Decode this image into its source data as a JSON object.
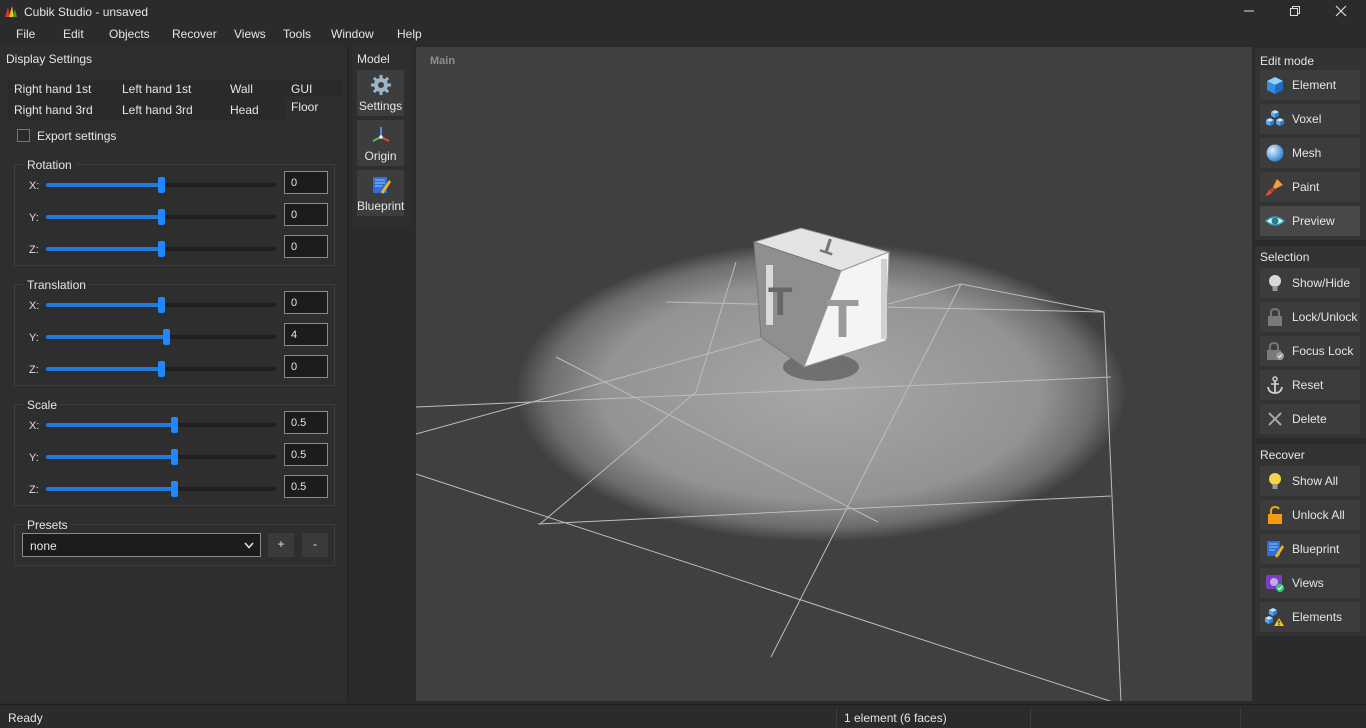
{
  "window": {
    "title": "Cubik Studio - unsaved"
  },
  "menu": [
    "File",
    "Edit",
    "Objects",
    "Recover",
    "Views",
    "Tools",
    "Window",
    "Help"
  ],
  "display_settings": {
    "title": "Display Settings",
    "tabs": [
      "Right hand 1st",
      "Left hand 1st",
      "Wall",
      "GUI",
      "Right hand 3rd",
      "Left hand 3rd",
      "Head",
      "Floor"
    ],
    "active_tab": "Floor",
    "export_label": "Export settings",
    "export_checked": false,
    "rotation": {
      "title": "Rotation",
      "x_label": "X:",
      "y_label": "Y:",
      "z_label": "Z:",
      "x": "0",
      "y": "0",
      "z": "0",
      "x_level": 0.5,
      "y_level": 0.5,
      "z_level": 0.5
    },
    "translation": {
      "title": "Translation",
      "x_label": "X:",
      "y_label": "Y:",
      "z_label": "Z:",
      "x": "0",
      "y": "4",
      "z": "0",
      "x_level": 0.5,
      "y_level": 0.525,
      "z_level": 0.5
    },
    "scale": {
      "title": "Scale",
      "x_label": "X:",
      "y_label": "Y:",
      "z_label": "Z:",
      "x": "0.5",
      "y": "0.5",
      "z": "0.5",
      "x_level": 0.56,
      "y_level": 0.56,
      "z_level": 0.56
    },
    "presets": {
      "title": "Presets",
      "value": "none",
      "add": "+",
      "remove": "-"
    }
  },
  "model": {
    "title": "Model",
    "settings": "Settings",
    "origin": "Origin",
    "blueprint": "Blueprint"
  },
  "viewport": {
    "label": "Main",
    "cube_face_letter": "T"
  },
  "edit_mode": {
    "title": "Edit mode",
    "items": [
      {
        "label": "Element",
        "icon": "cube-icon"
      },
      {
        "label": "Voxel",
        "icon": "voxel-icon"
      },
      {
        "label": "Mesh",
        "icon": "sphere-icon"
      },
      {
        "label": "Paint",
        "icon": "brush-icon"
      },
      {
        "label": "Preview",
        "icon": "eye-icon"
      }
    ],
    "active": "Preview"
  },
  "selection": {
    "title": "Selection",
    "items": [
      {
        "label": "Show/Hide",
        "icon": "bulb-icon"
      },
      {
        "label": "Lock/Unlock",
        "icon": "lock-icon"
      },
      {
        "label": "Focus Lock",
        "icon": "focus-lock-icon"
      },
      {
        "label": "Reset",
        "icon": "anchor-icon"
      },
      {
        "label": "Delete",
        "icon": "delete-icon"
      }
    ]
  },
  "recover": {
    "title": "Recover",
    "items": [
      {
        "label": "Show All",
        "icon": "bulb-lit-icon"
      },
      {
        "label": "Unlock All",
        "icon": "unlock-icon"
      },
      {
        "label": "Blueprint",
        "icon": "blueprint-icon"
      },
      {
        "label": "Views",
        "icon": "views-icon"
      },
      {
        "label": "Elements",
        "icon": "elements-warning-icon"
      }
    ]
  },
  "status": {
    "left": "Ready",
    "right": "1 element (6 faces)"
  },
  "colors": {
    "accent": "#1e88ff",
    "background": "#2b2b2b",
    "viewport": "#404040"
  }
}
